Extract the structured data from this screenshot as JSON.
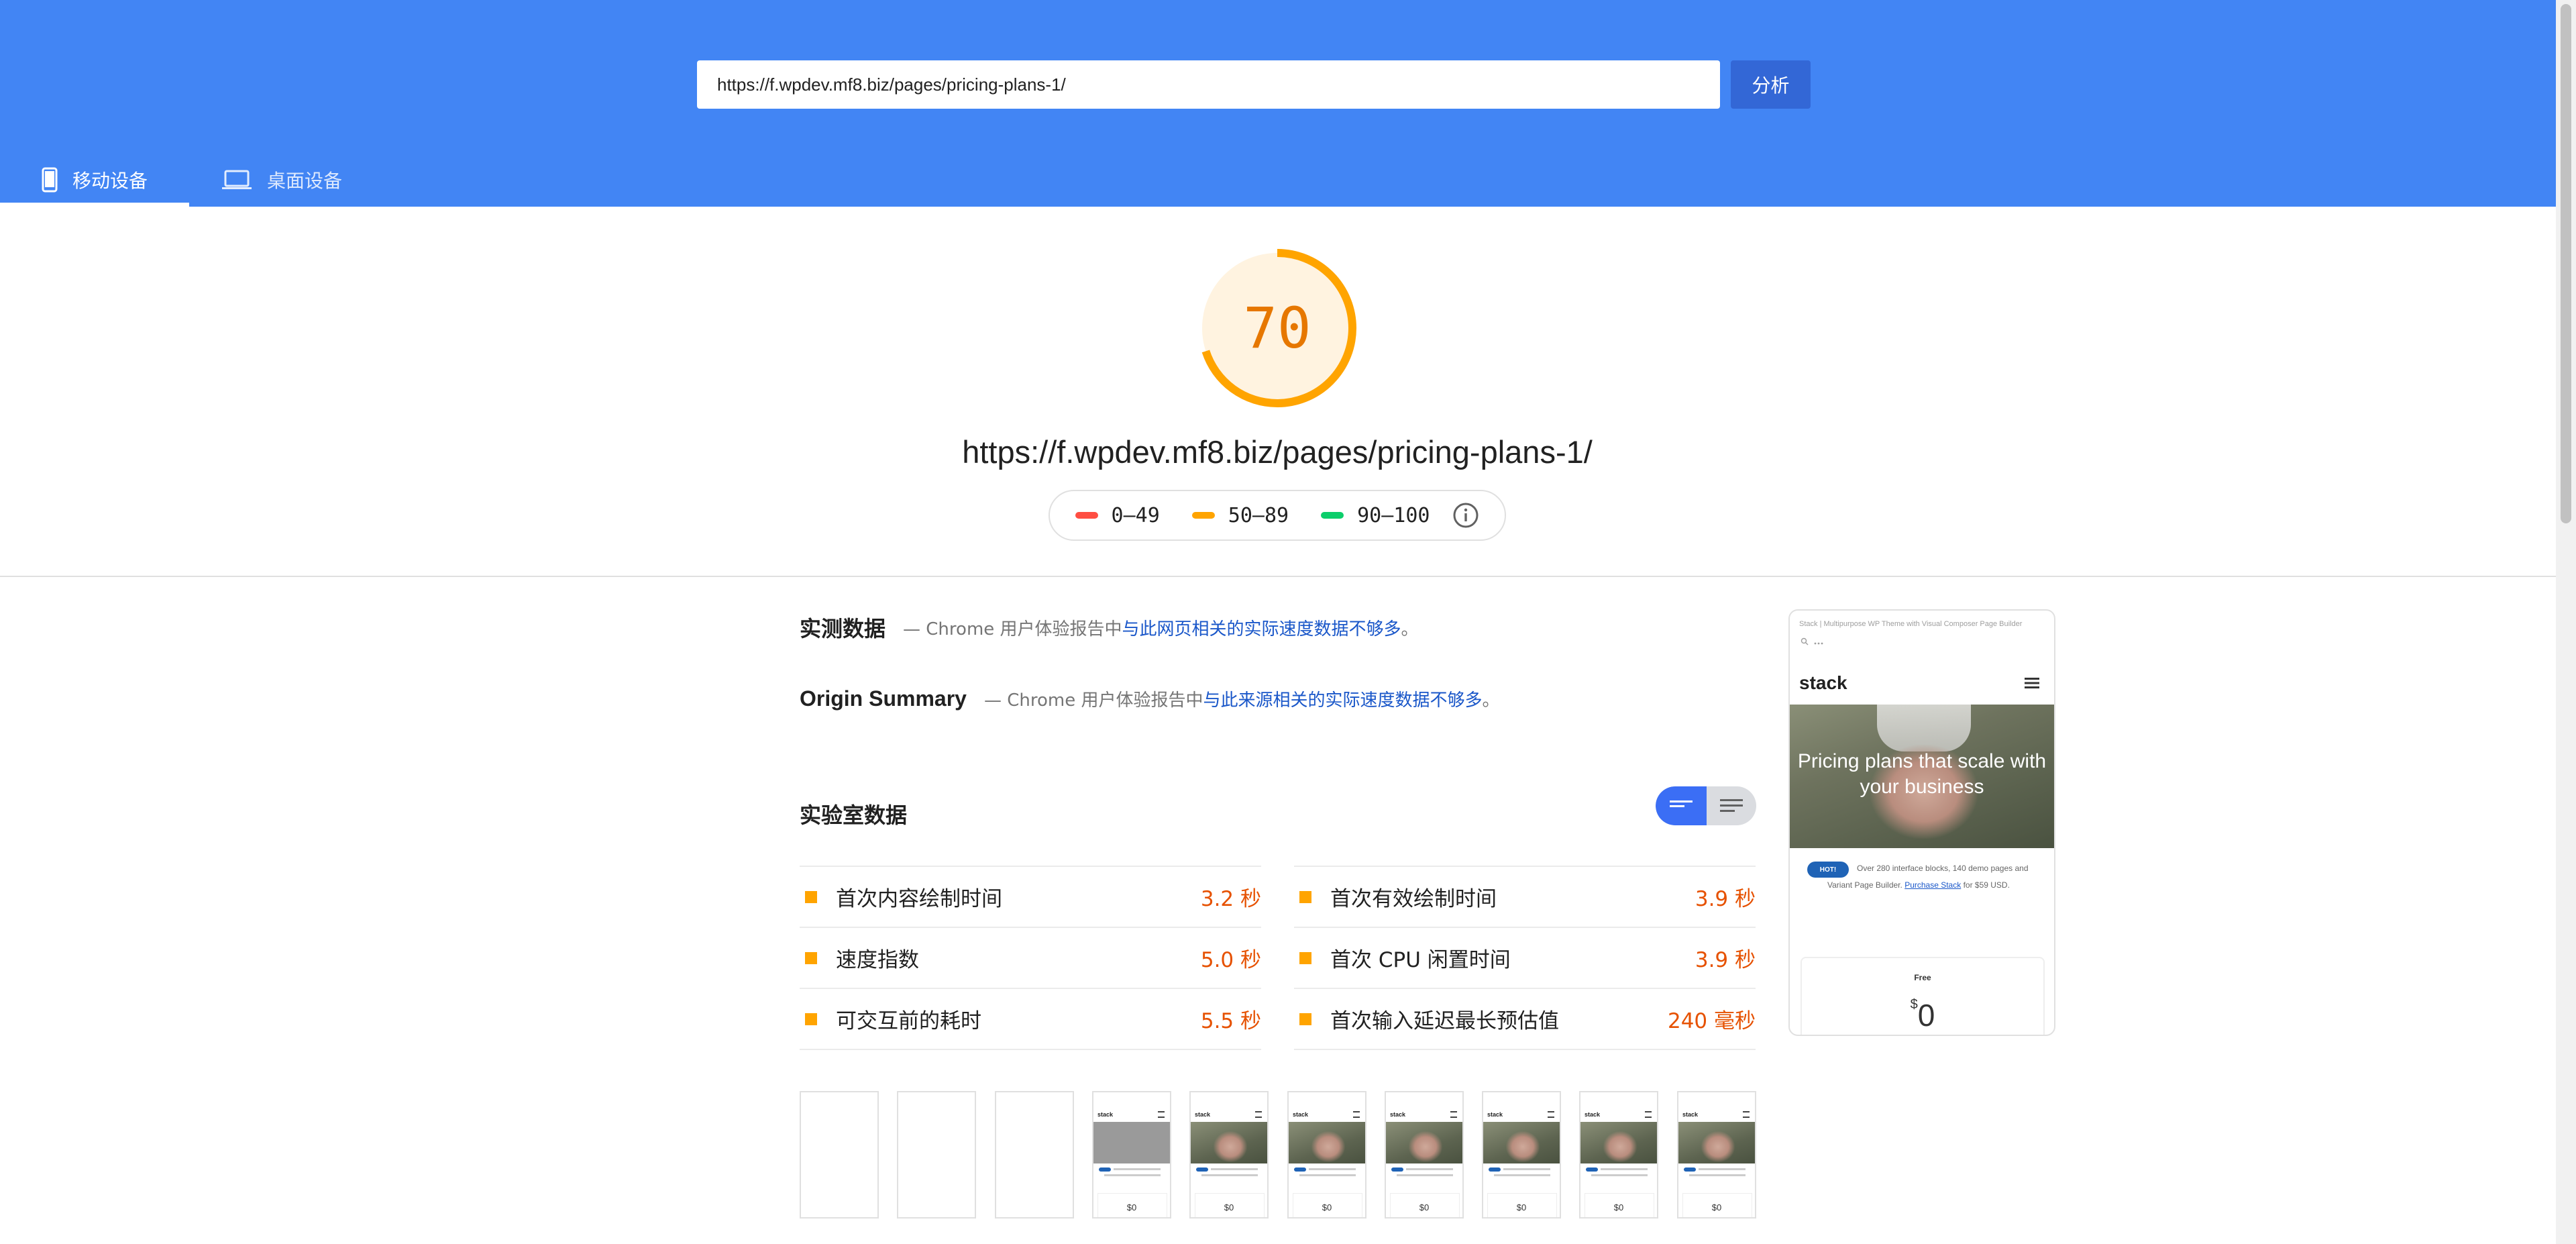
{
  "search": {
    "url_value": "https://f.wpdev.mf8.biz/pages/pricing-plans-1/",
    "analyze_label": "分析"
  },
  "tabs": [
    {
      "label": "移动设备",
      "icon": "smartphone-icon",
      "active": true
    },
    {
      "label": "桌面设备",
      "icon": "laptop-icon",
      "active": false
    }
  ],
  "colors": {
    "header_bg": "#4285f4",
    "analyze_bg": "#3367d6",
    "score_average": "#ffa400",
    "score_fail": "#ff4e42",
    "score_pass": "#0cce6b",
    "link": "#1a57c9",
    "metric_value": "#e65100"
  },
  "score": {
    "value": 70,
    "fraction": 0.7,
    "tested_url": "https://f.wpdev.mf8.biz/pages/pricing-plans-1/"
  },
  "legend": [
    {
      "range": "0–49",
      "color": "#ff4e42"
    },
    {
      "range": "50–89",
      "color": "#ffa400"
    },
    {
      "range": "90–100",
      "color": "#0cce6b"
    }
  ],
  "field_data": {
    "title": "实测数据",
    "desc_prefix": "— Chrome 用户体验报告中",
    "desc_link": "与此网页相关的实际速度数据不够多",
    "desc_suffix": "。"
  },
  "origin_summary": {
    "title": "Origin Summary",
    "desc_prefix": "— Chrome 用户体验报告中",
    "desc_link": "与此来源相关的实际速度数据不够多",
    "desc_suffix": "。"
  },
  "lab_data": {
    "title": "实验室数据",
    "metrics_left": [
      {
        "label": "首次内容绘制时间",
        "value": "3.2 秒"
      },
      {
        "label": "速度指数",
        "value": "5.0 秒"
      },
      {
        "label": "可交互前的耗时",
        "value": "5.5 秒"
      }
    ],
    "metrics_right": [
      {
        "label": "首次有效绘制时间",
        "value": "3.9 秒"
      },
      {
        "label": "首次 CPU 闲置时间",
        "value": "3.9 秒"
      },
      {
        "label": "首次输入延迟最长预估值",
        "value": "240 毫秒"
      }
    ]
  },
  "preview": {
    "tab_title": "Stack | Multipurpose WP Theme with Visual Composer Page Builder",
    "logo": "stack",
    "hero_text": "Pricing plans that scale with your business",
    "hot_badge": "HOT!",
    "desc_line1": "Over 280 interface blocks, 140 demo pages and",
    "desc_line2_prefix": "Variant Page Builder. ",
    "desc_line2_link": "Purchase Stack",
    "desc_line2_suffix": " for $59 USD.",
    "plan_name": "Free",
    "price_currency": "$",
    "price_value": "0"
  },
  "filmstrip": {
    "frames": [
      "blank",
      "blank",
      "blank",
      "loading",
      "loaded",
      "loaded",
      "loaded",
      "loaded",
      "loaded",
      "loaded"
    ],
    "logo": "stack",
    "price": "$0"
  }
}
